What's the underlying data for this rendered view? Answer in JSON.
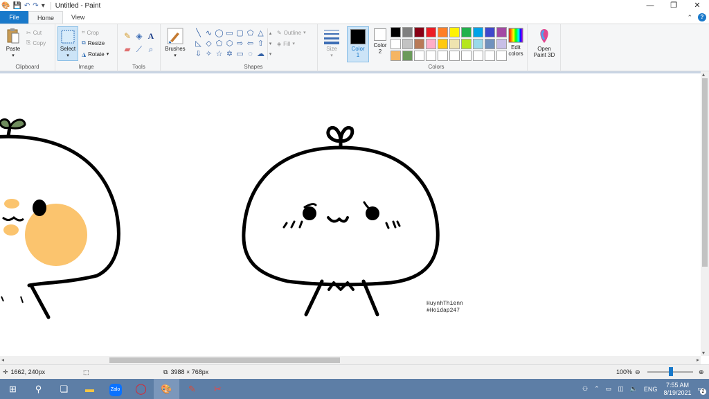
{
  "titlebar": {
    "title": "Untitled - Paint",
    "minimize": "—",
    "maximize": "❐",
    "close": "✕"
  },
  "tabs": {
    "file": "File",
    "home": "Home",
    "view": "View"
  },
  "ribbon": {
    "clipboard": {
      "label": "Clipboard",
      "paste": "Paste",
      "cut": "Cut",
      "copy": "Copy"
    },
    "image": {
      "label": "Image",
      "select": "Select",
      "crop": "Crop",
      "resize": "Resize",
      "rotate": "Rotate"
    },
    "tools": {
      "label": "Tools"
    },
    "brushes": {
      "label": "Brushes"
    },
    "shapes": {
      "label": "Shapes",
      "outline": "Outline",
      "fill": "Fill"
    },
    "size": {
      "label": "Size"
    },
    "color1": {
      "label": "Color",
      "index": "1"
    },
    "color2": {
      "label": "Color",
      "index": "2"
    },
    "colors": {
      "label": "Colors",
      "edit": "Edit colors"
    },
    "paint3d": {
      "label": "Open Paint 3D"
    }
  },
  "palette": [
    "#000000",
    "#7f7f7f",
    "#880015",
    "#ed1c24",
    "#ff7f27",
    "#fff200",
    "#22b14c",
    "#00a2e8",
    "#3f48cc",
    "#a349a4",
    "#ffffff",
    "#c3c3c3",
    "#b97a57",
    "#ffaec9",
    "#ffc90e",
    "#efe4b0",
    "#b5e61d",
    "#99d9ea",
    "#7092be",
    "#c8bfe7",
    "#f5b562",
    "#6a9a5a",
    "#ffffff",
    "#ffffff",
    "#ffffff",
    "#ffffff",
    "#ffffff",
    "#ffffff",
    "#ffffff",
    "#ffffff"
  ],
  "canvas": {
    "signature_line1": "HuynhThienn",
    "signature_line2": "#Hoidap247",
    "blush_color": "#fbc46e",
    "sprout_color": "#6f8c5d"
  },
  "status": {
    "cursor_pos": "1662, 240px",
    "image_size": "3988 × 768px",
    "zoom": "100%"
  },
  "taskbar": {
    "time": "7:55 AM",
    "date": "8/19/2021",
    "lang": "ENG",
    "notifications": "2"
  },
  "accent": "#1979ca"
}
